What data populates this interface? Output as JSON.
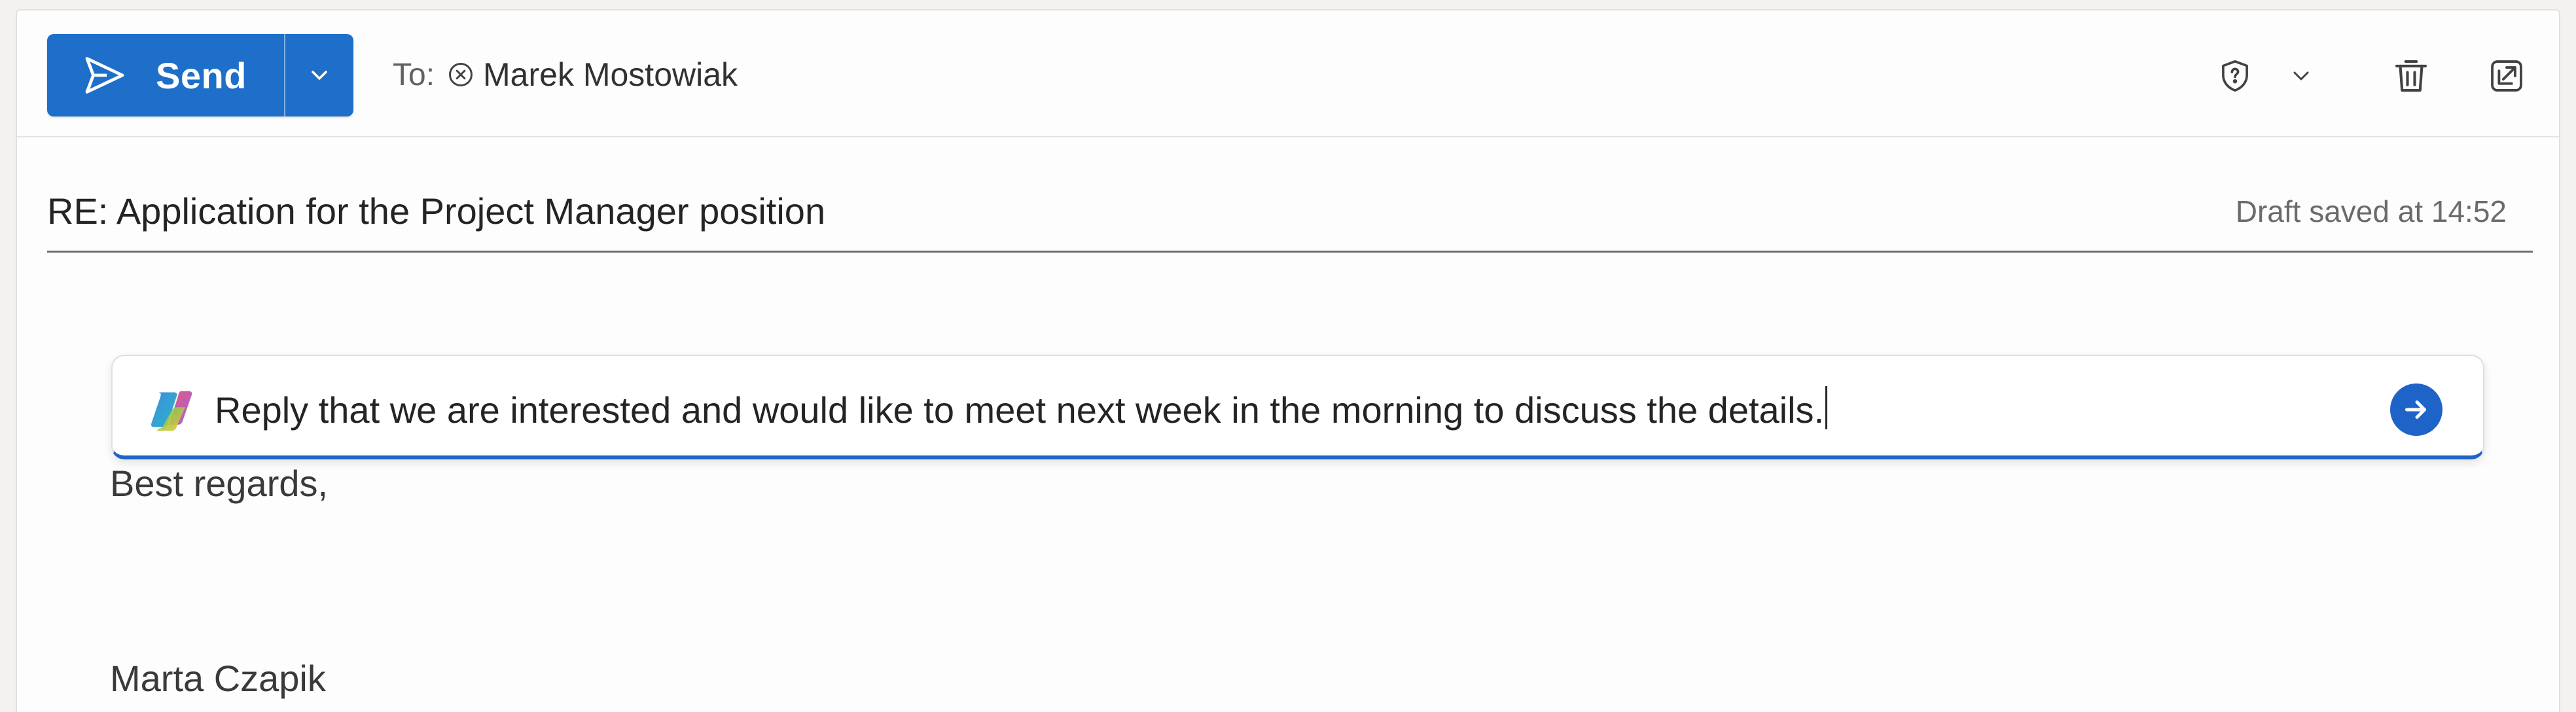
{
  "toolbar": {
    "send_label": "Send",
    "to_label": "To:",
    "recipient": "Marek Mostowiak"
  },
  "subject": "RE: Application for the Project Manager position",
  "draft_status": "Draft saved at 14:52",
  "copilot": {
    "prompt": "Reply that we are interested and would like to meet next week in the morning to discuss the details."
  },
  "body": {
    "closing": "Best regards,",
    "signature": "Marta Czapik"
  },
  "icons": {
    "send": "send-icon",
    "dropdown": "chevron-down-icon",
    "remove_recipient": "remove-recipient-icon",
    "sensitivity": "shield-question-icon",
    "delete": "trash-icon",
    "popout": "pop-out-icon",
    "copilot": "copilot-icon",
    "submit": "arrow-right-icon"
  },
  "colors": {
    "accent": "#1e6fc9",
    "copilot_underline": "#1e64c8"
  }
}
